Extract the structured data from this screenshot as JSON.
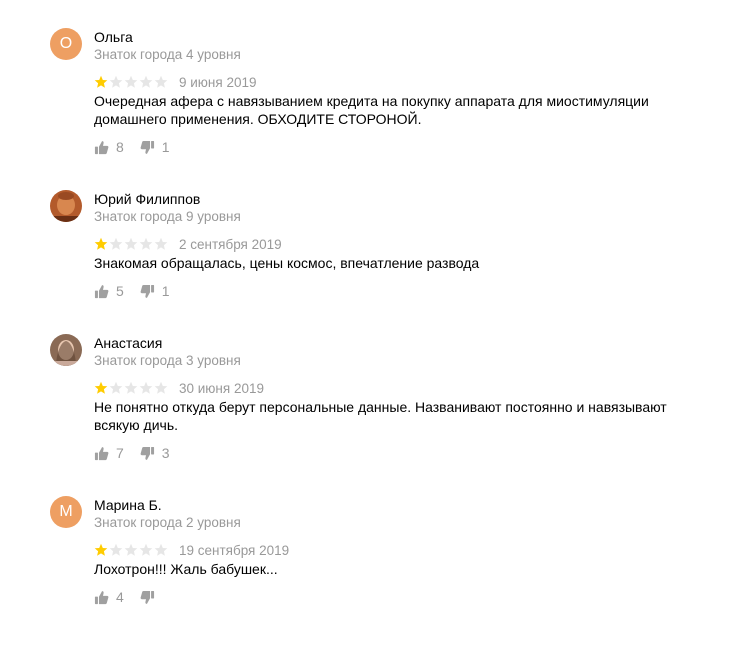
{
  "reviews": [
    {
      "author": "Ольга",
      "avatar_letter": "О",
      "level": "Знаток города 4 уровня",
      "rating": 1,
      "rating_max": 5,
      "date": "9 июня 2019",
      "text": "Очередная афера с навязыванием кредита на покупку аппарата для миостимуляции домашнего применения. ОБХОДИТЕ СТОРОНОЙ.",
      "likes": "8",
      "dislikes": "1"
    },
    {
      "author": "Юрий Филиппов",
      "level": "Знаток города 9 уровня",
      "rating": 1,
      "rating_max": 5,
      "date": "2 сентября 2019",
      "text": "Знакомая обращалась, цены космос, впечатление развода",
      "likes": "5",
      "dislikes": "1"
    },
    {
      "author": "Анастасия",
      "level": "Знаток города 3 уровня",
      "rating": 1,
      "rating_max": 5,
      "date": "30 июня 2019",
      "text": "Не понятно откуда берут персональные данные. Названивают постоянно и навязывают всякую дичь.",
      "likes": "7",
      "dislikes": "3"
    },
    {
      "author": "Марина Б.",
      "avatar_letter": "М",
      "level": "Знаток города 2 уровня",
      "rating": 1,
      "rating_max": 5,
      "date": "19 сентября 2019",
      "text": "Лохотрон!!! Жаль бабушек...",
      "likes": "4",
      "dislikes": ""
    }
  ],
  "colors": {
    "star_filled": "#fc0",
    "star_empty": "#e6e6e6",
    "avatar_letter_bg": "#ee9f62",
    "muted_text": "#999999",
    "vote_icon": "#a0a0a0"
  },
  "icons": {
    "like": "thumbs-up-icon",
    "dislike": "thumbs-down-icon",
    "star": "star-icon"
  }
}
